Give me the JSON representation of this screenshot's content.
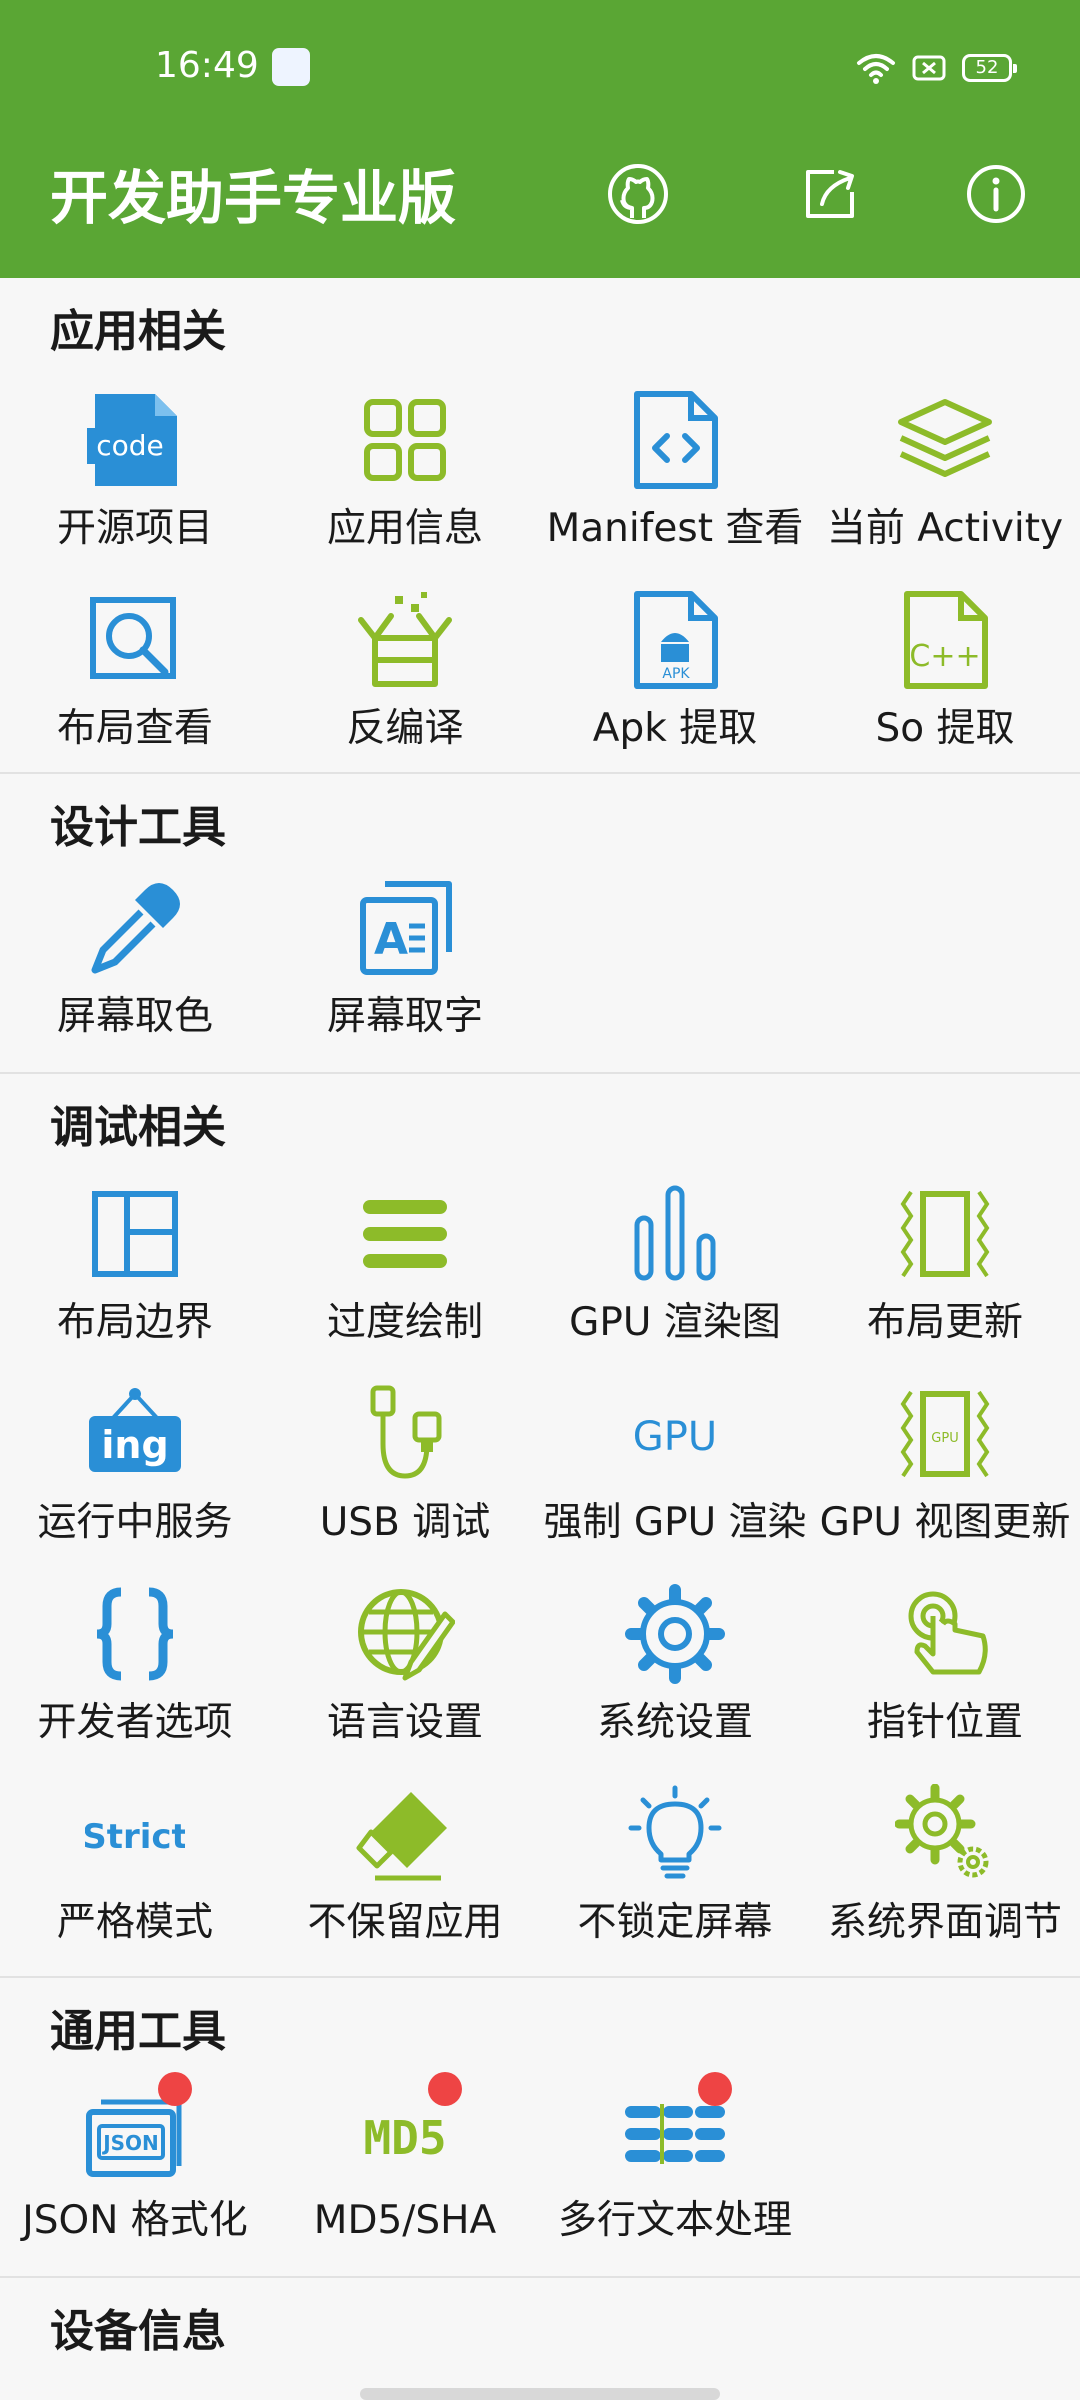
{
  "status_bar": {
    "time": "16:49",
    "battery": "52"
  },
  "app_bar": {
    "title": "开发助手专业版"
  },
  "sections": {
    "app": {
      "title": "应用相关",
      "items": [
        "开源项目",
        "应用信息",
        "Manifest 查看",
        "当前 Activity",
        "布局查看",
        "反编译",
        "Apk 提取",
        "So 提取"
      ],
      "icon_text": {
        "code": "code",
        "apk": "APK",
        "cpp": "C++"
      }
    },
    "design": {
      "title": "设计工具",
      "items": [
        "屏幕取色",
        "屏幕取字"
      ]
    },
    "debug": {
      "title": "调试相关",
      "items": [
        "布局边界",
        "过度绘制",
        "GPU 渲染图",
        "布局更新",
        "运行中服务",
        "USB 调试",
        "强制 GPU 渲染",
        "GPU 视图更新",
        "开发者选项",
        "语言设置",
        "系统设置",
        "指针位置",
        "严格模式",
        "不保留应用",
        "不锁定屏幕",
        "系统界面调节"
      ],
      "icon_text": {
        "ing": "ing",
        "gpu": "GPU",
        "gpu_v": "GPU",
        "strict": "Strict"
      }
    },
    "general": {
      "title": "通用工具",
      "items": [
        "JSON 格式化",
        "MD5/SHA",
        "多行文本处理"
      ],
      "icon_text": {
        "json": "JSON",
        "md5": "MD5"
      }
    },
    "device": {
      "title": "设备信息"
    }
  },
  "colors": {
    "green": "#5aa634",
    "blue": "#2a8fd6",
    "lime": "#8dbb29",
    "badge": "#ee4444"
  }
}
